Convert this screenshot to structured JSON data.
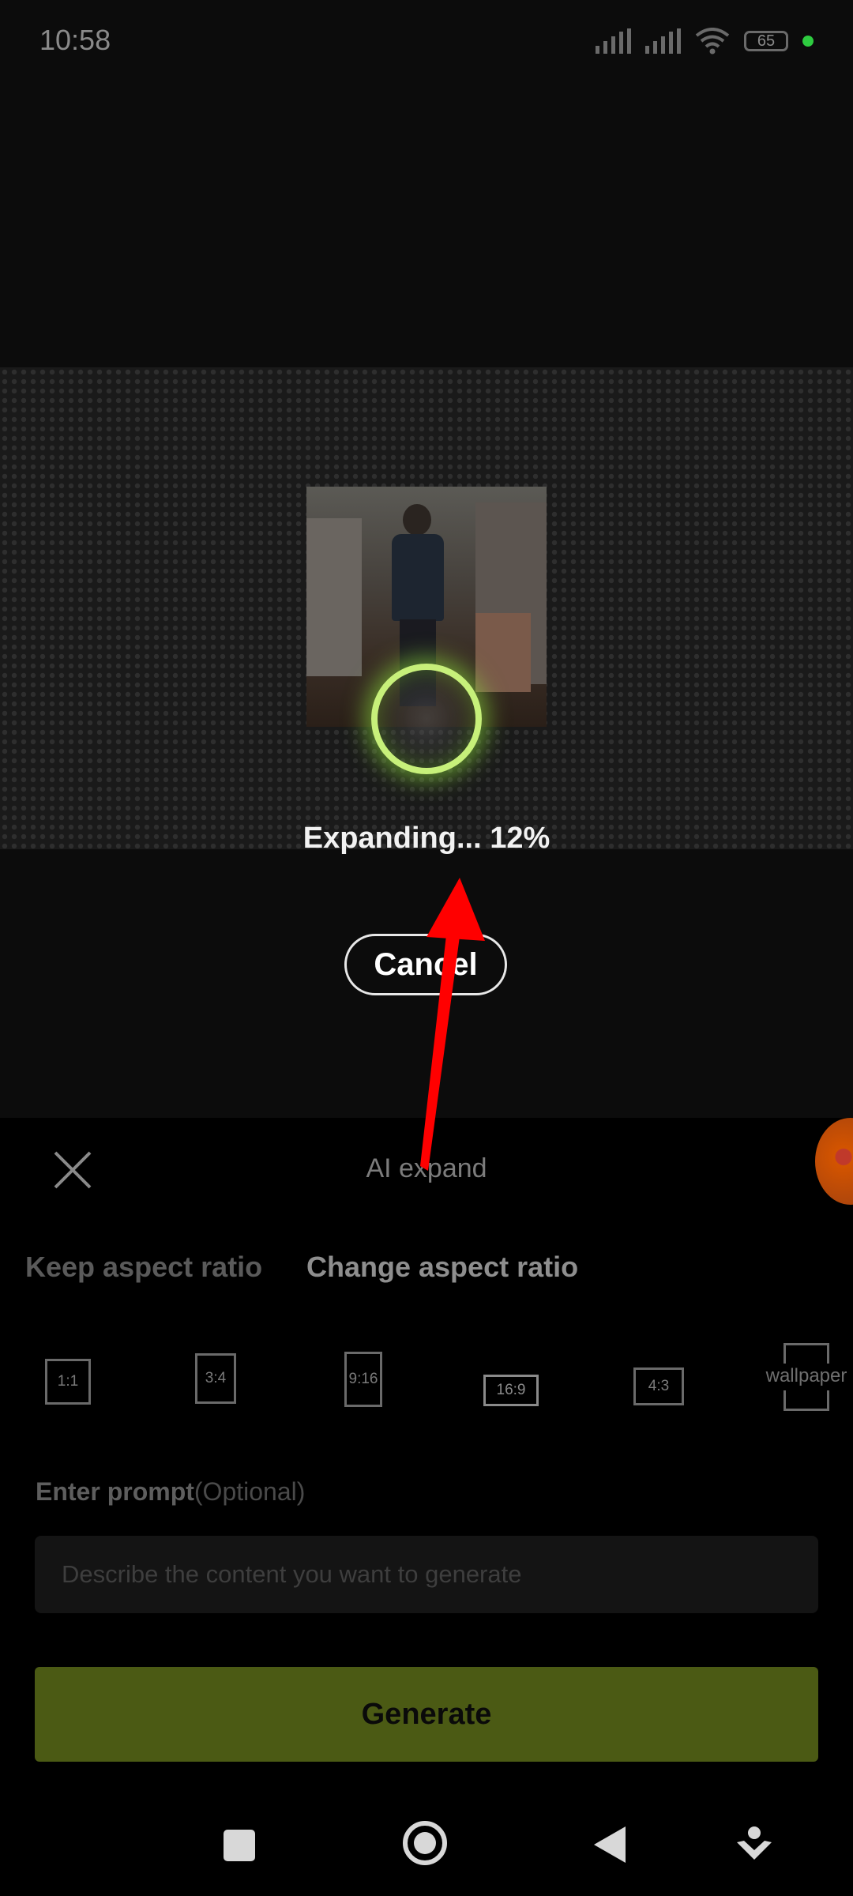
{
  "status_bar": {
    "time": "10:58",
    "battery": "65"
  },
  "progress": {
    "text": "Expanding... 12%",
    "percent": 12
  },
  "cancel_label": "Cancel",
  "sheet": {
    "title": "AI expand",
    "tabs": [
      {
        "label": "Keep aspect ratio",
        "selected": false
      },
      {
        "label": "Change aspect ratio",
        "selected": true
      }
    ],
    "ratios": [
      "1:1",
      "3:4",
      "9:16",
      "16:9",
      "4:3",
      "wallpaper"
    ],
    "prompt_label": "Enter prompt",
    "prompt_optional": "(Optional)",
    "prompt_placeholder": "Describe the content you want to generate",
    "generate_label": "Generate"
  },
  "colors": {
    "accent": "#4b5a14",
    "spinner": "#c7f07a",
    "annotation_arrow": "#ff0000"
  },
  "icons": {
    "close": "close-icon",
    "nav_recents": "square-icon",
    "nav_home": "circle-icon",
    "nav_back": "triangle-back-icon",
    "nav_extra": "download-icon"
  }
}
